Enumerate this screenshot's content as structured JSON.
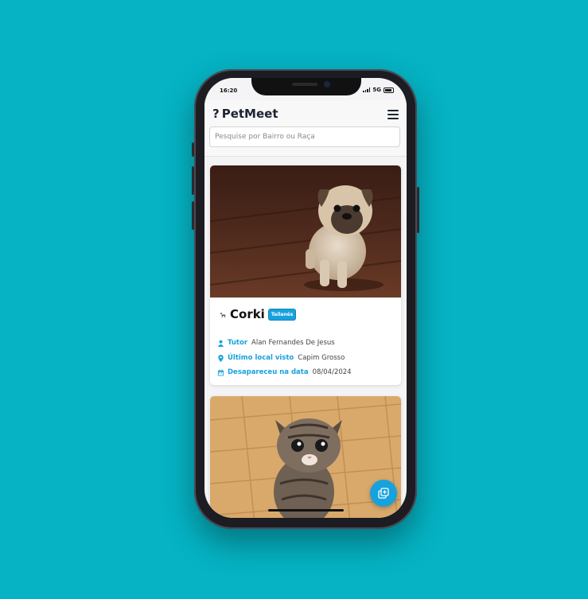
{
  "status": {
    "time": "16:20",
    "network": "5G"
  },
  "header": {
    "app_name": "PetMeet",
    "logo_icon": "question-mark-icon",
    "menu_icon": "hamburger-menu-icon",
    "search_placeholder": "Pesquise por Bairro ou Raça"
  },
  "cards": [
    {
      "photo": "pug-puppy-photo",
      "species_icon": "dog-icon",
      "name": "Corki",
      "badge": "Tailanês",
      "tutor_label": "Tutor",
      "tutor_value": "Alan Fernandes De Jesus",
      "location_label": "Último local visto",
      "location_value": "Capim Grosso",
      "date_label": "Desapareceu na data",
      "date_value": "08/04/2024"
    },
    {
      "photo": "tabby-kitten-photo"
    }
  ],
  "fab_icon": "add-post-icon",
  "colors": {
    "accent": "#17a2dd",
    "background": "#05b3c4"
  }
}
